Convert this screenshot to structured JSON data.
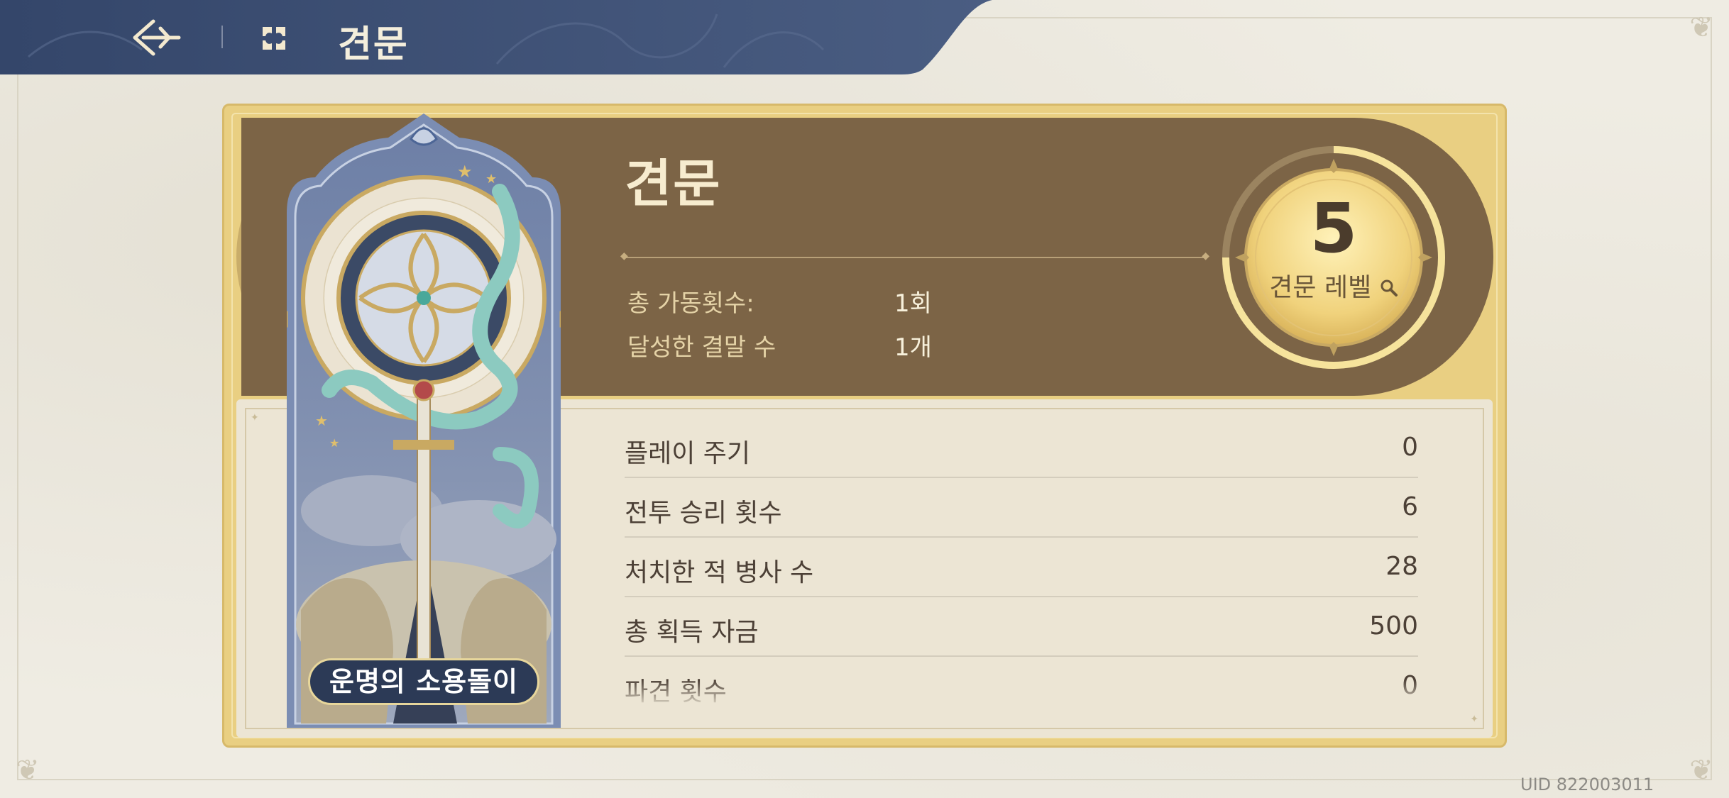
{
  "header": {
    "title": "견문",
    "back_icon": "back-arrow-icon",
    "menu_icon": "quatrefoil-menu-icon"
  },
  "card": {
    "name": "운명의 소용돌이"
  },
  "summary": {
    "title": "견문",
    "items": [
      {
        "label": "총 가동횟수:",
        "value": "1회"
      },
      {
        "label": "달성한 결말 수",
        "value": "1개"
      }
    ]
  },
  "level": {
    "value": "5",
    "label": "견문 레벨"
  },
  "stats": [
    {
      "label": "플레이 주기",
      "value": "0"
    },
    {
      "label": "전투 승리 횟수",
      "value": "6"
    },
    {
      "label": "처치한 적 병사 수",
      "value": "28"
    },
    {
      "label": "총 획득 자금",
      "value": "500"
    },
    {
      "label": "파견 횟수",
      "value": "0"
    }
  ],
  "uid": "UID 822003011",
  "colors": {
    "header_bg": "#3c4d70",
    "panel_gold": "#e9cf82",
    "band_brown": "#7c6446",
    "badge_gold": "#f3d982"
  }
}
